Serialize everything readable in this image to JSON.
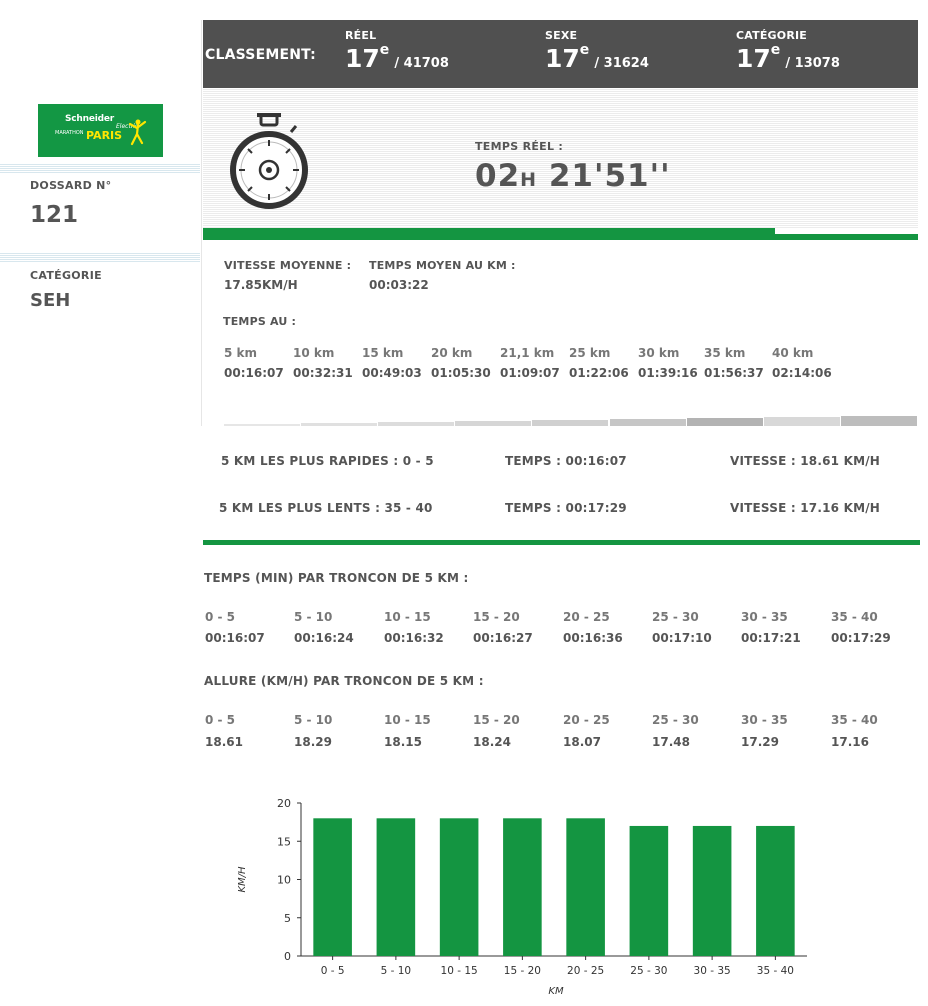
{
  "sidebar": {
    "logo": {
      "brand": "Schneider",
      "sub": "Electric",
      "event_a": "MARATHON",
      "event_b": "PARIS",
      "color": "#139744"
    },
    "dossard_label": "DOSSARD N°",
    "dossard_value": "121",
    "categorie_label": "CATÉGORIE",
    "categorie_value": "SEH"
  },
  "classement": {
    "title": "CLASSEMENT:",
    "items": [
      {
        "label": "RÉEL",
        "rank": "17",
        "suffix": "e",
        "total": "/ 41708"
      },
      {
        "label": "SEXE",
        "rank": "17",
        "suffix": "e",
        "total": "/ 31624"
      },
      {
        "label": "CATÉGORIE",
        "rank": "17",
        "suffix": "e",
        "total": "/ 13078"
      }
    ]
  },
  "temps_reel": {
    "label": "TEMPS RÉEL :",
    "hours": "02",
    "hours_unit": "H",
    "rest": "21'51''",
    "icon": "stopwatch-icon"
  },
  "progress": {
    "fraction": 0.8
  },
  "stats": {
    "vitesse_label": "VITESSE MOYENNE :",
    "vitesse_value": "17.85KM/H",
    "temps_km_label": "TEMPS MOYEN AU KM :",
    "temps_km_value": "00:03:22"
  },
  "temps_au": {
    "label": "TEMPS AU :",
    "splits": [
      {
        "km": "5 km",
        "time": "00:16:07"
      },
      {
        "km": "10 km",
        "time": "00:32:31"
      },
      {
        "km": "15 km",
        "time": "00:49:03"
      },
      {
        "km": "20 km",
        "time": "01:05:30"
      },
      {
        "km": "21,1 km",
        "time": "01:09:07"
      },
      {
        "km": "25 km",
        "time": "01:22:06"
      },
      {
        "km": "30 km",
        "time": "01:39:16"
      },
      {
        "km": "35 km",
        "time": "01:56:37"
      },
      {
        "km": "40 km",
        "time": "02:14:06"
      }
    ]
  },
  "fast_slow": {
    "fast_label": "5 KM LES PLUS RAPIDES : 0 - 5",
    "fast_temps": "TEMPS : 00:16:07",
    "fast_vitesse": "VITESSE : 18.61 KM/H",
    "slow_label": "5 KM LES PLUS LENTS : 35 - 40",
    "slow_temps": "TEMPS : 00:17:29",
    "slow_vitesse": "VITESSE : 17.16 KM/H"
  },
  "troncons_temps": {
    "title": "TEMPS (MIN) PAR TRONCON DE 5 KM :",
    "items": [
      {
        "seg": "0 - 5",
        "val": "00:16:07"
      },
      {
        "seg": "5 - 10",
        "val": "00:16:24"
      },
      {
        "seg": "10 - 15",
        "val": "00:16:32"
      },
      {
        "seg": "15 - 20",
        "val": "00:16:27"
      },
      {
        "seg": "20 - 25",
        "val": "00:16:36"
      },
      {
        "seg": "25 - 30",
        "val": "00:17:10"
      },
      {
        "seg": "30 - 35",
        "val": "00:17:21"
      },
      {
        "seg": "35 - 40",
        "val": "00:17:29"
      }
    ]
  },
  "troncons_allure": {
    "title": "ALLURE (KM/H) PAR TRONCON DE 5 KM :",
    "items": [
      {
        "seg": "0 - 5",
        "val": "18.61"
      },
      {
        "seg": "5 - 10",
        "val": "18.29"
      },
      {
        "seg": "10 - 15",
        "val": "18.15"
      },
      {
        "seg": "15 - 20",
        "val": "18.24"
      },
      {
        "seg": "20 - 25",
        "val": "18.07"
      },
      {
        "seg": "25 - 30",
        "val": "17.48"
      },
      {
        "seg": "30 - 35",
        "val": "17.29"
      },
      {
        "seg": "35 - 40",
        "val": "17.16"
      }
    ]
  },
  "chart_data": {
    "type": "bar",
    "categories": [
      "0 - 5",
      "5 - 10",
      "10 - 15",
      "15 - 20",
      "20 - 25",
      "25 - 30",
      "30 - 35",
      "35 - 40"
    ],
    "values": [
      18,
      18,
      18,
      18,
      18,
      17,
      17,
      17
    ],
    "xlabel": "KM",
    "ylabel": "KM/H",
    "ylim": [
      0,
      20
    ],
    "yticks": [
      "0",
      "5",
      "10",
      "15",
      "20"
    ],
    "grid": false,
    "bar_color": "#149541"
  },
  "colors": {
    "accent_green": "#149541",
    "header_bg": "#505050"
  }
}
